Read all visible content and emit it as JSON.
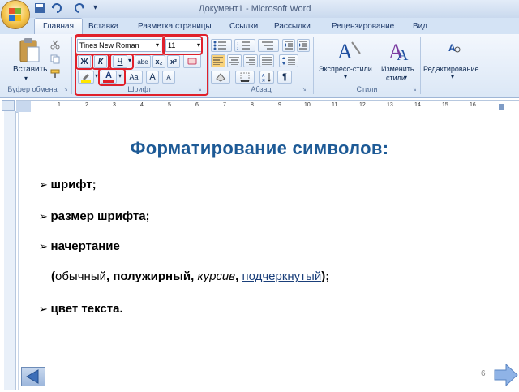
{
  "window": {
    "title": "Документ1 - Microsoft Word"
  },
  "tabs": [
    "Главная",
    "Вставка",
    "Разметка страницы",
    "Ссылки",
    "Рассылки",
    "Рецензирование",
    "Вид"
  ],
  "ribbon": {
    "clipboard": {
      "paste_label": "Вставить",
      "group_label": "Буфер обмена"
    },
    "font": {
      "font_name": "Tines New Roman",
      "font_size": "11",
      "group_label": "Шрифт",
      "bold": "Ж",
      "italic": "К",
      "underline": "Ч",
      "strike": "abe",
      "subscript": "x₂",
      "superscript": "x²",
      "font_color": "А",
      "change_case": "Aa",
      "grow": "A",
      "shrink": "A"
    },
    "paragraph": {
      "group_label": "Абзац"
    },
    "styles": {
      "express_styles": "Экспресс-стили",
      "change_styles_1": "Изменить",
      "change_styles_2": "стили",
      "group_label": "Стили"
    },
    "editing": {
      "label": "Редактирование"
    }
  },
  "ruler": [
    "1",
    "2",
    "3",
    "4",
    "5",
    "6",
    "7",
    "8",
    "9",
    "10",
    "11",
    "12",
    "13",
    "14",
    "15",
    "16"
  ],
  "slide": {
    "title": "Форматирование символов:",
    "bullets": [
      "шрифт;",
      "размер шрифта;",
      "начертание"
    ],
    "styles_line": {
      "open": "(",
      "normal": "обычный",
      "sep1": ", ",
      "bold": "полужирный",
      "sep2": ", ",
      "italic": "курсив",
      "sep3": ", ",
      "underlined": "подчеркнутый",
      "close": ");"
    },
    "last_bullet": "цвет текста.",
    "page_number": "6"
  },
  "colors": {
    "title": "#1d5a96",
    "highlight_box": "#e0202a"
  }
}
